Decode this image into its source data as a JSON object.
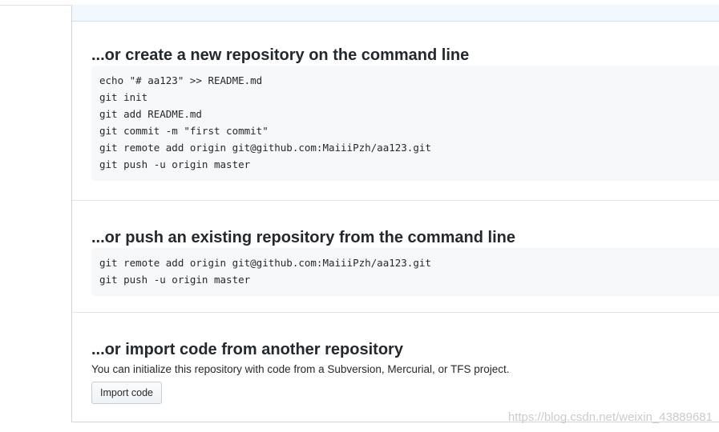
{
  "sections": {
    "create": {
      "title": "...or create a new repository on the command line",
      "lines": [
        "echo \"# aa123\" >> README.md",
        "git init",
        "git add README.md",
        "git commit -m \"first commit\"",
        "git remote add origin git@github.com:MaiiiPzh/aa123.git",
        "git push -u origin master"
      ]
    },
    "push": {
      "title": "...or push an existing repository from the command line",
      "lines": [
        "git remote add origin git@github.com:MaiiiPzh/aa123.git",
        "git push -u origin master"
      ]
    },
    "import": {
      "title": "...or import code from another repository",
      "description": "You can initialize this repository with code from a Subversion, Mercurial, or TFS project.",
      "button_label": "Import code"
    }
  },
  "watermark": "https://blog.csdn.net/weixin_43889681"
}
